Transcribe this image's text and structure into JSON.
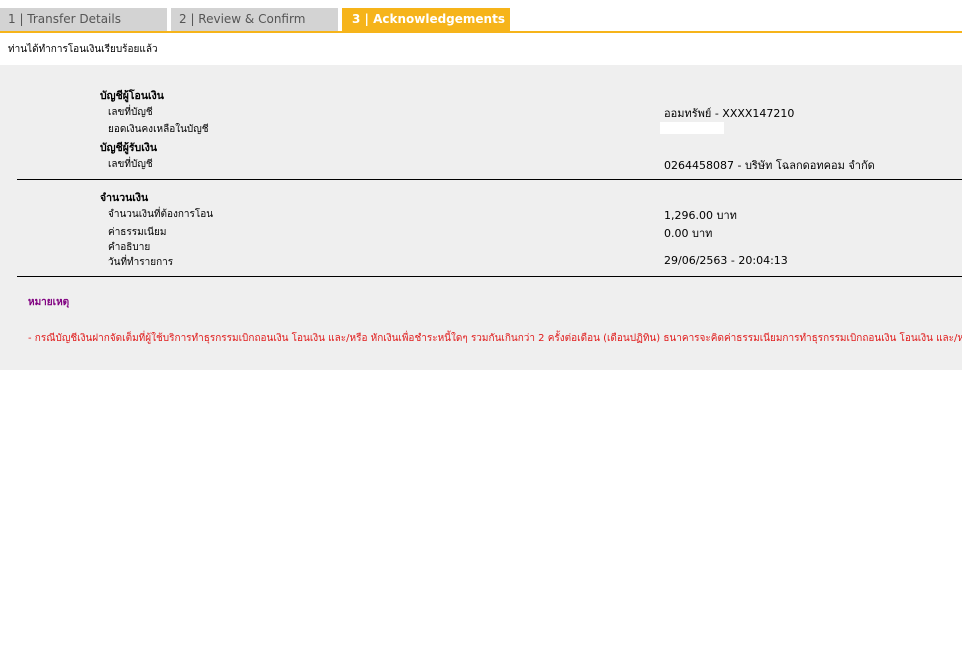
{
  "tabs": [
    {
      "label": "1 | Transfer Details"
    },
    {
      "label": "2 | Review & Confirm"
    },
    {
      "label": "3 | Acknowledgements"
    }
  ],
  "message": "ท่านได้ทำการโอนเงินเรียบร้อยแล้ว",
  "from_section": {
    "heading": "บัญชีผู้โอนเงิน",
    "account_label": "เลขที่บัญชี",
    "account_value": "ออมทรัพย์ - XXXX147210",
    "balance_label": "ยอดเงินคงเหลือในบัญชี"
  },
  "to_section": {
    "heading": "บัญชีผู้รับเงิน",
    "account_label": "เลขที่บัญชี",
    "account_value": "0264458087 - บริษัท โฉลกดอทคอม จำกัด"
  },
  "amount_section": {
    "heading": "จำนวนเงิน",
    "amount_label": "จำนวนเงินที่ต้องการโอน",
    "amount_value": "1,296.00 บาท",
    "fee_label": "ค่าธรรมเนียม",
    "fee_value": "0.00  บาท",
    "description_label": "คำอธิบาย",
    "date_label": "วันที่ทำรายการ",
    "date_value": "29/06/2563 - 20:04:13"
  },
  "note": {
    "title": "หมายเหตุ",
    "text": "- กรณีบัญชีเงินฝากจัดเต็มที่ผู้ใช้บริการทำธุรกรรมเบิกถอนเงิน โอนเงิน และ/หรือ หักเงินเพื่อชำระหนี้ใดๆ รวมกันเกินกว่า 2 ครั้งต่อเดือน (เดือนปฏิทิน) ธนาคารจะคิดค่าธรรมเนียมการทำธุรกรรมเบิกถอนเงิน โอนเงิน และ/หรือ หักเงิน"
  }
}
